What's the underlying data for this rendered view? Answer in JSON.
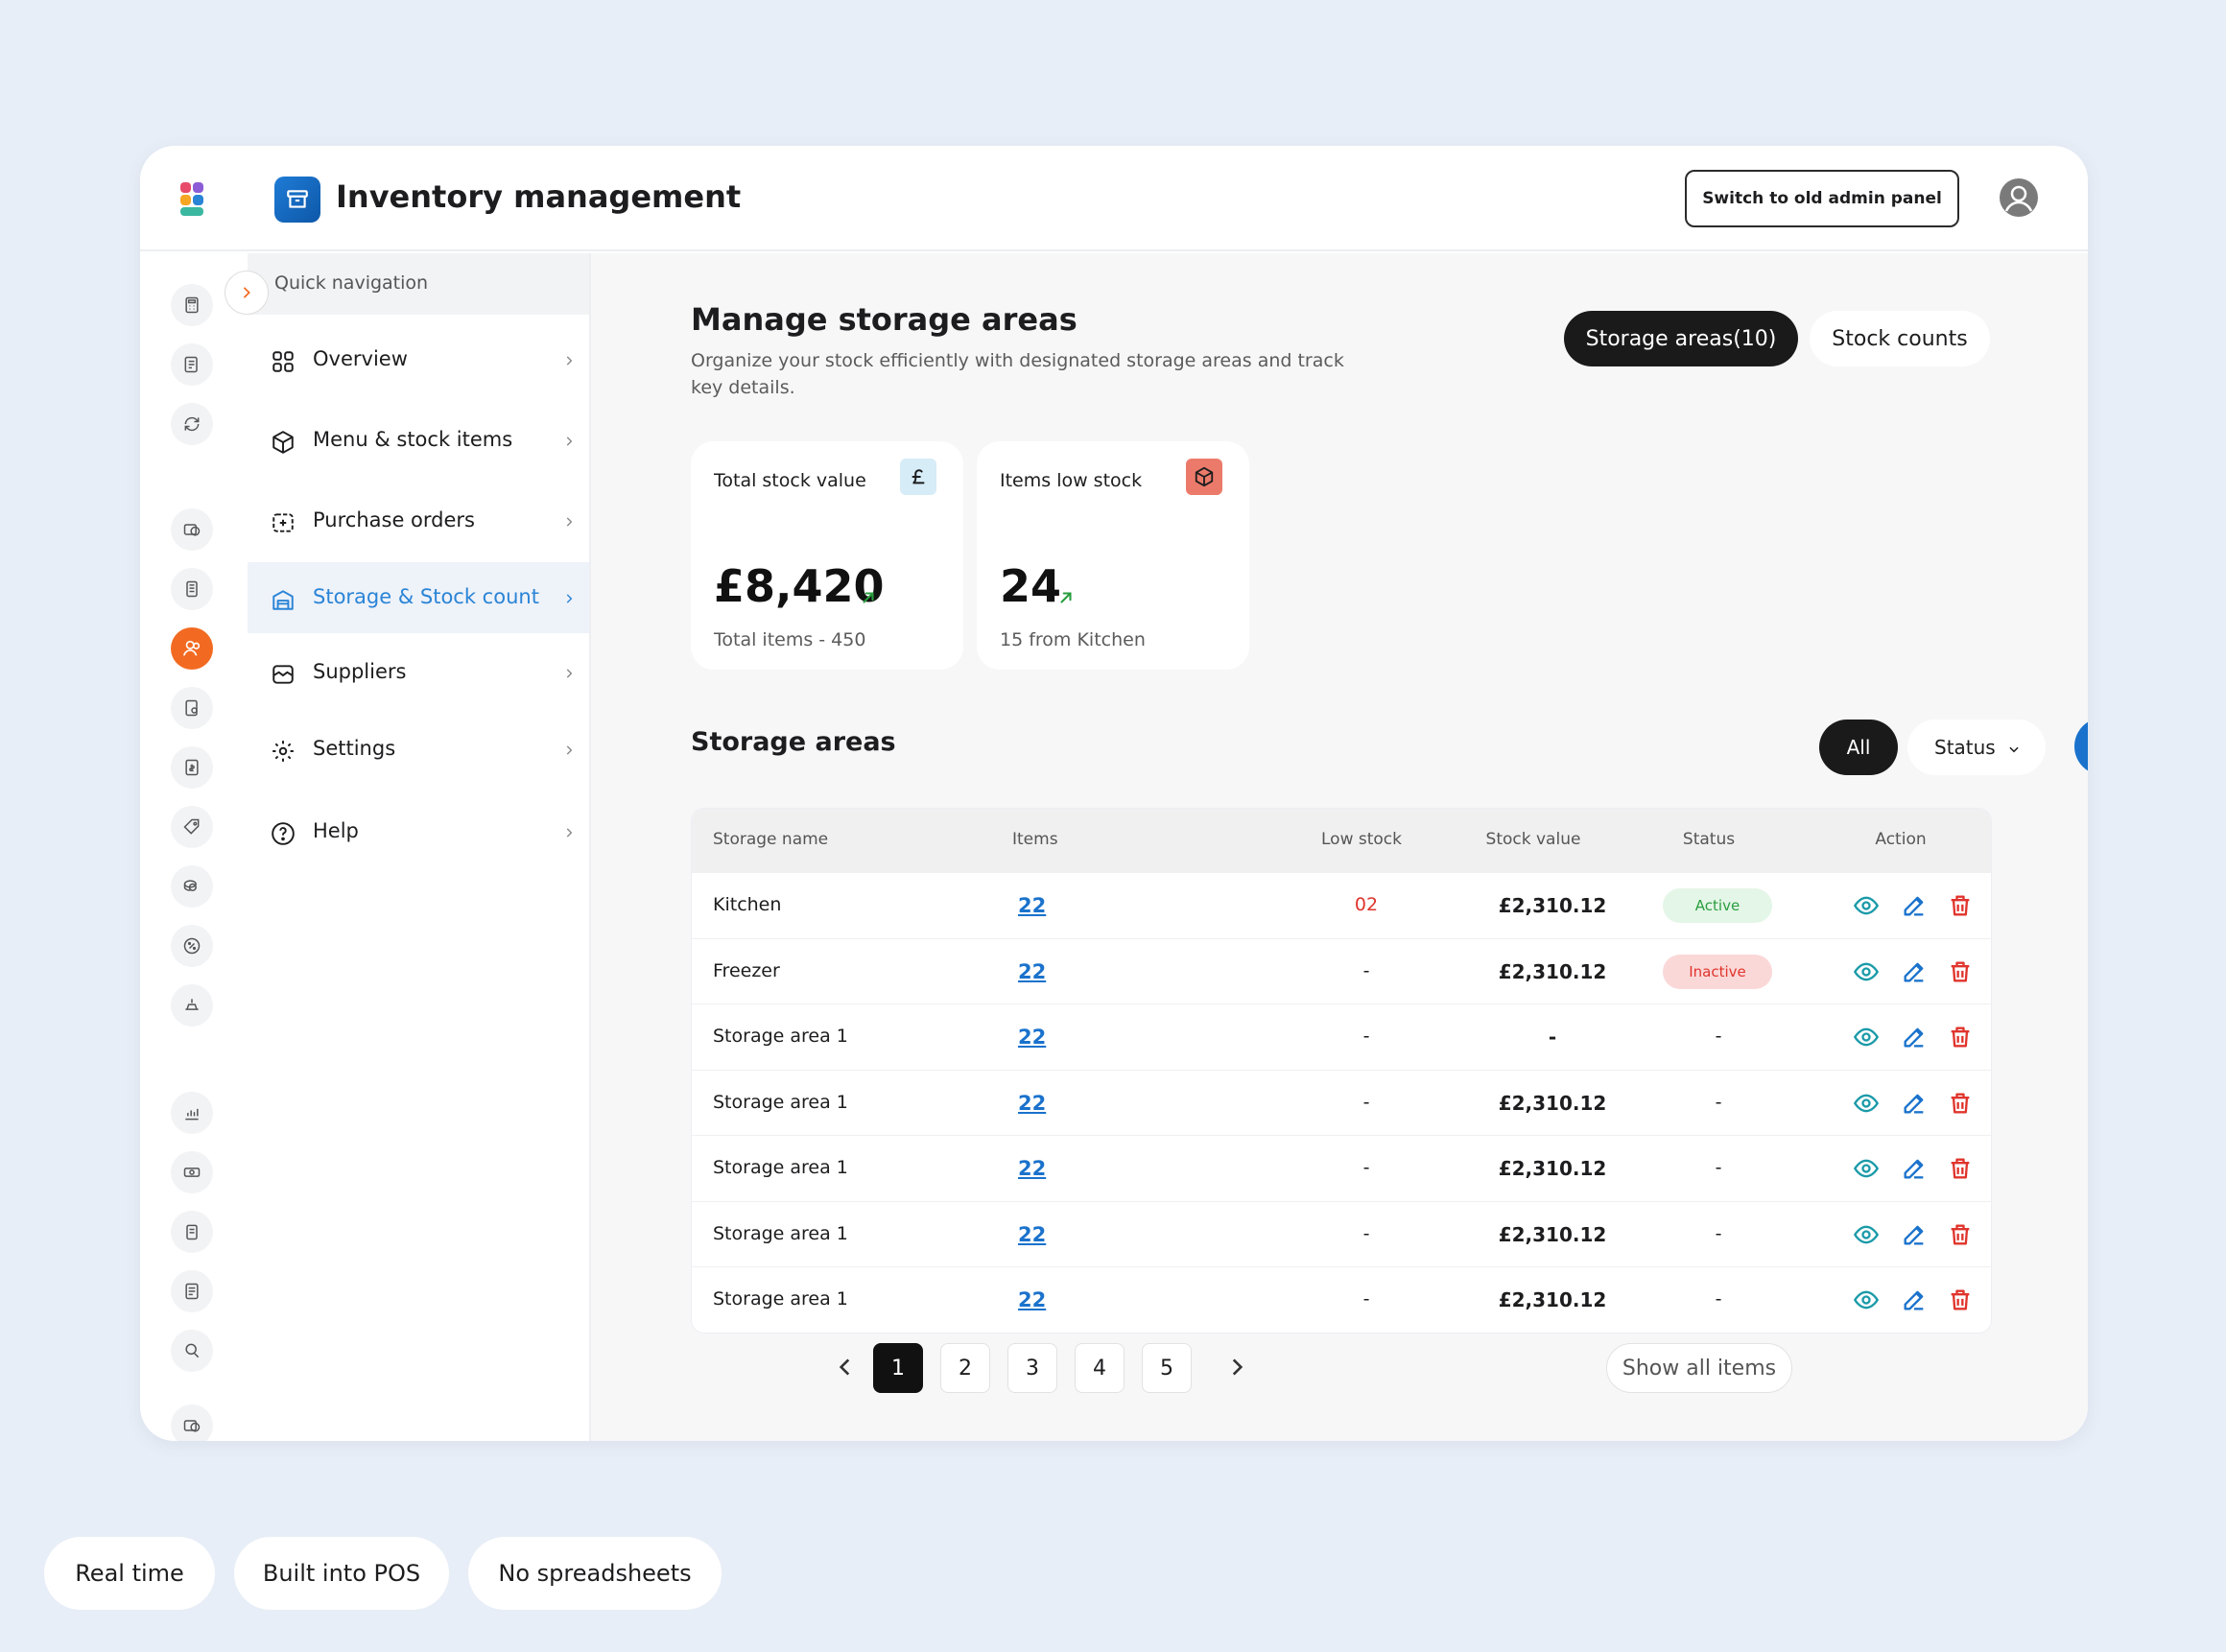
{
  "header": {
    "title": "Inventory management",
    "switch_label": "Switch to old admin panel"
  },
  "nav": {
    "heading": "Quick navigation",
    "items": [
      {
        "label": "Overview"
      },
      {
        "label": "Menu & stock items"
      },
      {
        "label": "Purchase orders"
      },
      {
        "label": "Storage & Stock count"
      },
      {
        "label": "Suppliers"
      },
      {
        "label": "Settings"
      },
      {
        "label": "Help"
      }
    ]
  },
  "page": {
    "title": "Manage storage areas",
    "subtitle": "Organize your stock efficiently with designated storage areas and track key details.",
    "tabs": {
      "storage": "Storage areas(10)",
      "counts": "Stock counts"
    }
  },
  "cards": {
    "total_value": {
      "label": "Total stock value",
      "value": "£8,420",
      "sub": "Total items  -  450"
    },
    "low_stock": {
      "label": "Items low stock",
      "value": "24",
      "sub": "15 from Kitchen"
    }
  },
  "storage": {
    "title": "Storage areas",
    "filter_all": "All",
    "filter_status": "Status",
    "columns": [
      "Storage name",
      "Items",
      "Low stock",
      "Stock value",
      "Status",
      "Action"
    ],
    "rows": [
      {
        "name": "Kitchen",
        "items": "22",
        "low": "02",
        "value": "£2,310.12",
        "status": "Active"
      },
      {
        "name": "Freezer",
        "items": "22",
        "low": "-",
        "value": "£2,310.12",
        "status": "Inactive"
      },
      {
        "name": "Storage area 1",
        "items": "22",
        "low": "-",
        "value": "-",
        "status": "-"
      },
      {
        "name": "Storage area 1",
        "items": "22",
        "low": "-",
        "value": "£2,310.12",
        "status": "-"
      },
      {
        "name": "Storage area 1",
        "items": "22",
        "low": "-",
        "value": "£2,310.12",
        "status": "-"
      },
      {
        "name": "Storage area 1",
        "items": "22",
        "low": "-",
        "value": "£2,310.12",
        "status": "-"
      },
      {
        "name": "Storage area 1",
        "items": "22",
        "low": "-",
        "value": "£2,310.12",
        "status": "-"
      }
    ]
  },
  "pagination": {
    "pages": [
      "1",
      "2",
      "3",
      "4",
      "5"
    ],
    "current": "1",
    "show_all": "Show all items"
  },
  "chips": [
    "Real time",
    "Built into POS",
    "No spreadsheets"
  ],
  "colors": {
    "accent_orange": "#f26a21",
    "accent_blue": "#1a72cc",
    "active_green": "#2a9d3f",
    "danger_red": "#e0342c"
  }
}
